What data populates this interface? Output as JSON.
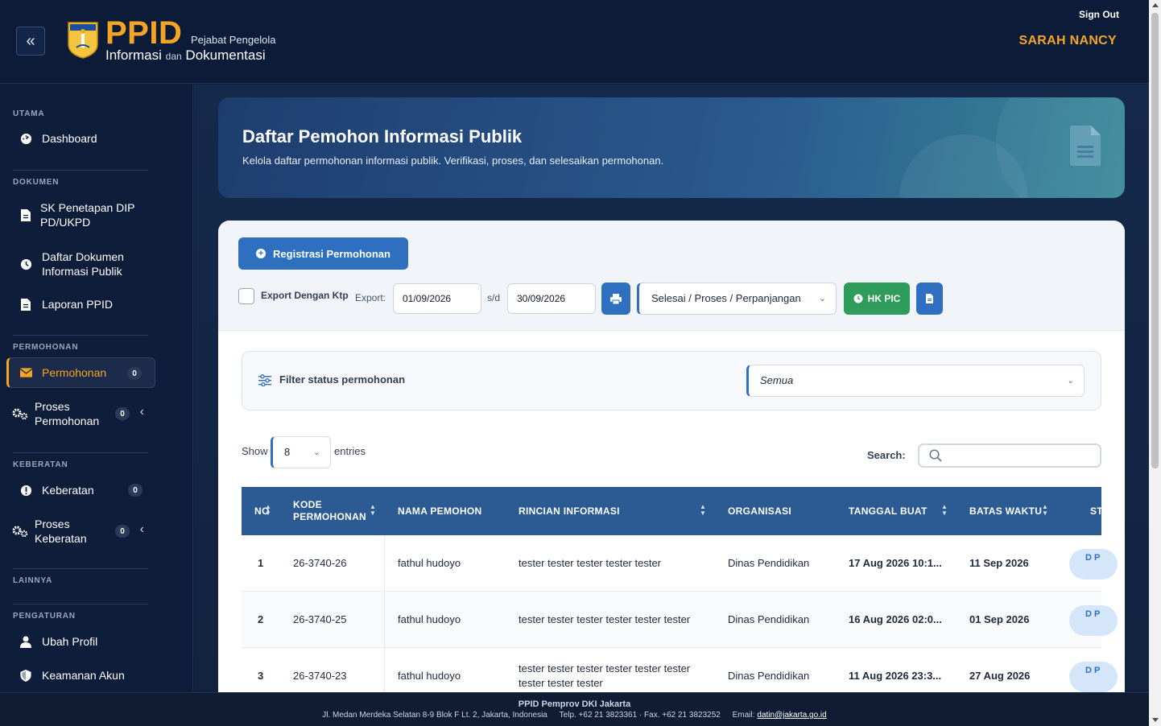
{
  "header": {
    "logo_main": "PPID",
    "logo_sub1": "Pejabat Pengelola",
    "logo_sub2_a": "Informasi",
    "logo_sub2_b": "dan",
    "logo_sub2_c": "Dokumentasi",
    "signout_label": "Sign Out",
    "username": "SARAH NANCY",
    "accent_color": "#f5a524"
  },
  "sidebar": {
    "sections": {
      "utama": "UTAMA",
      "dokumen": "DOKUMEN",
      "permohonan": "PERMOHONAN",
      "keberatan": "KEBERATAN",
      "lainnya": "LAINNYA",
      "pengaturan": "PENGATURAN"
    },
    "items": {
      "dashboard": {
        "label": "Dashboard",
        "icon": "dashboard-icon"
      },
      "sk_penetapan": {
        "label": "SK Penetapan DIP PD/UKPD",
        "icon": "file-icon"
      },
      "daftar_dokumen": {
        "label": "Daftar Dokumen Informasi Publik",
        "icon": "clock-icon"
      },
      "laporan": {
        "label": "Laporan PPID",
        "icon": "file-icon"
      },
      "permohonan": {
        "label": "Permohonan",
        "badge": "0",
        "icon": "envelope-icon"
      },
      "proses_permohonan": {
        "label": "Proses Permohonan",
        "badge": "0",
        "icon": "cogs-icon"
      },
      "keberatan": {
        "label": "Keberatan",
        "badge": "0",
        "icon": "exclamation-icon"
      },
      "proses_keberatan": {
        "label": "Proses Keberatan",
        "badge": "0",
        "icon": "cogs-icon"
      },
      "ubah_profil": {
        "label": "Ubah Profil",
        "icon": "user-icon"
      },
      "keamanan_akun": {
        "label": "Keamanan Akun",
        "icon": "shield-icon"
      }
    }
  },
  "hero": {
    "title": "Daftar Pemohon Informasi Publik",
    "description": "Kelola daftar permohonan informasi publik. Verifikasi, proses, dan selesaikan permohonan."
  },
  "toolbar": {
    "register_label": "Registrasi Permohonan",
    "export_ktp_label": "Export Dengan Ktp",
    "export_label": "Export:",
    "date_from": "01/09/2026",
    "sd_label": "s/d",
    "date_to": "30/09/2026",
    "status_select": "Selesai / Proses / Perpanjangan",
    "hk_pic_label": "HK PIC"
  },
  "filter": {
    "label": "Filter status permohonan",
    "selected": "Semua"
  },
  "table_controls": {
    "show_label": "Show",
    "entries_value": "8",
    "entries_label": "entries",
    "search_label": "Search:",
    "search_value": ""
  },
  "table": {
    "columns": {
      "no": "NO",
      "kode": "KODE PERMOHONAN",
      "nama": "NAMA PEMOHON",
      "rincian": "RINCIAN INFORMASI",
      "organisasi": "ORGANISASI",
      "tanggal": "TANGGAL BUAT",
      "batas": "BATAS WAKTU",
      "status": "ST"
    },
    "rows": [
      {
        "no": "1",
        "kode": "26-3740-26",
        "nama": "fathul hudoyo",
        "rincian": "tester tester tester tester tester",
        "organisasi": "Dinas Pendidikan",
        "tanggal": "17 Aug 2026 10:1...",
        "batas": "11 Sep 2026",
        "status": "D P"
      },
      {
        "no": "2",
        "kode": "26-3740-25",
        "nama": "fathul hudoyo",
        "rincian": "tester tester tester tester tester tester",
        "organisasi": "Dinas Pendidikan",
        "tanggal": "16 Aug 2026 02:0...",
        "batas": "01 Sep 2026",
        "status": "D P"
      },
      {
        "no": "3",
        "kode": "26-3740-23",
        "nama": "fathul hudoyo",
        "rincian": "tester tester tester tester tester tester tester tester tester",
        "organisasi": "Dinas Pendidikan",
        "tanggal": "11 Aug 2026 23:3...",
        "batas": "27 Aug 2026",
        "status": "D P"
      }
    ]
  },
  "footer": {
    "title": "PPID Pemprov DKI Jakarta",
    "address": "Jl. Medan Merdeka Selatan 8-9 Blok F Lt. 2, Jakarta, Indonesia",
    "phone": "Telp. +62 21 3823361 · Fax. +62 21 3823252",
    "email_label": "Email:",
    "email": "datin@jakarta.go.id"
  }
}
